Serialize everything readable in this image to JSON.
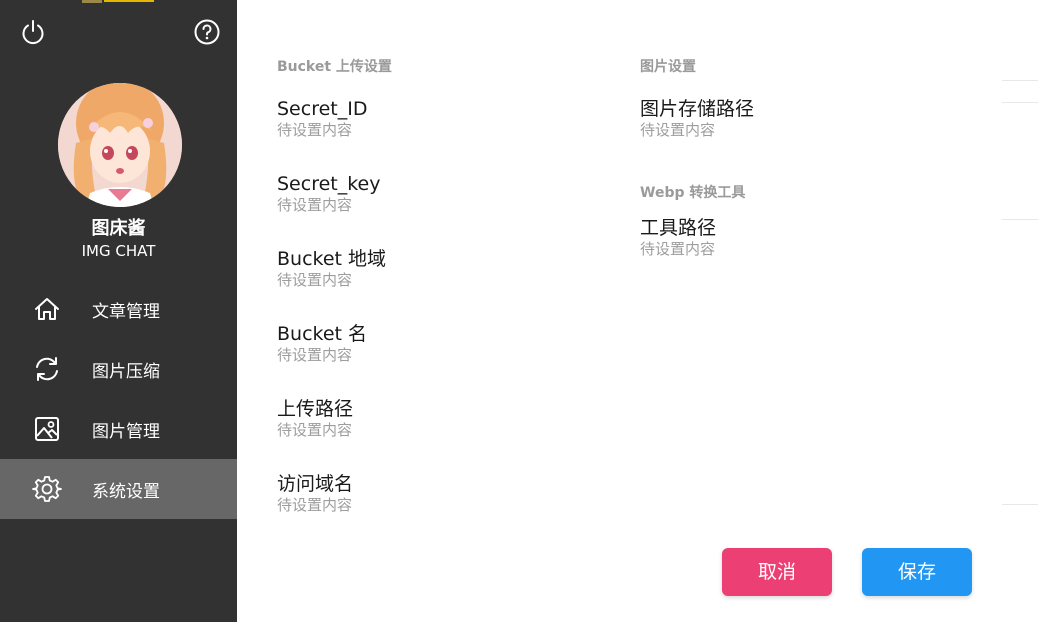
{
  "sidebar": {
    "app_name": "图床酱",
    "app_subtitle": "IMG CHAT",
    "items": [
      {
        "label": "文章管理",
        "icon": "home-icon"
      },
      {
        "label": "图片压缩",
        "icon": "sync-icon"
      },
      {
        "label": "图片管理",
        "icon": "image-icon"
      },
      {
        "label": "系统设置",
        "icon": "gear-icon",
        "active": true
      }
    ]
  },
  "bucket_section": {
    "title": "Bucket 上传设置",
    "fields": [
      {
        "label": "Secret_ID",
        "value": "待设置内容"
      },
      {
        "label": "Secret_key",
        "value": "待设置内容"
      },
      {
        "label": "Bucket 地域",
        "value": "待设置内容"
      },
      {
        "label": "Bucket 名",
        "value": "待设置内容"
      },
      {
        "label": "上传路径",
        "value": "待设置内容"
      },
      {
        "label": "访问域名",
        "value": "待设置内容"
      }
    ]
  },
  "image_section": {
    "title": "图片设置",
    "fields": [
      {
        "label": "图片存储路径",
        "value": "待设置内容"
      }
    ]
  },
  "webp_section": {
    "title": "Webp 转换工具",
    "fields": [
      {
        "label": "工具路径",
        "value": "待设置内容"
      }
    ]
  },
  "actions": {
    "cancel_label": "取消",
    "save_label": "保存"
  },
  "colors": {
    "sidebar_bg": "#323232",
    "active_item_bg": "#676767",
    "cancel": "#ec3f73",
    "save": "#2196f3"
  }
}
